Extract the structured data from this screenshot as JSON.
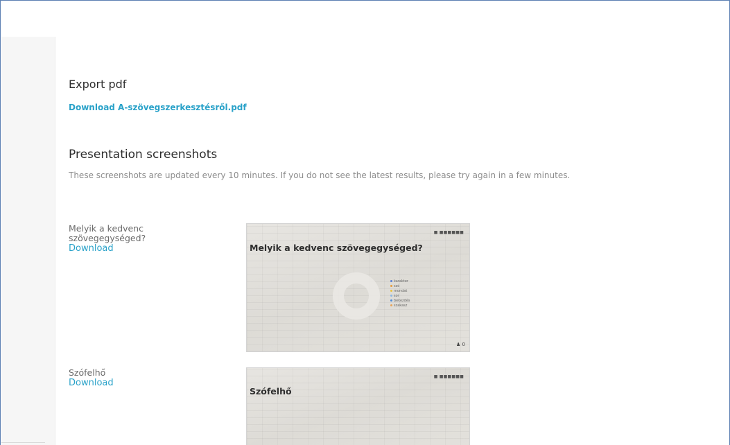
{
  "export": {
    "title": "Export pdf",
    "download_label": "Download A-szövegszerkesztésről.pdf"
  },
  "screenshots": {
    "title": "Presentation screenshots",
    "notice": "These screenshots are updated every 10 minutes. If you do not see the latest results, please try again in a few minutes.",
    "items": [
      {
        "label": "Melyik a kedvenc szövegegységed?",
        "download_label": "Download",
        "slide": {
          "title": "Melyik a kedvenc szövegegységed?",
          "legend": [
            {
              "label": "karakter",
              "color": "#5b7fd1"
            },
            {
              "label": "szó",
              "color": "#e59b3c"
            },
            {
              "label": "mondat",
              "color": "#e8c23e"
            },
            {
              "label": "sor",
              "color": "#8fb7e0"
            },
            {
              "label": "bekezdés",
              "color": "#4f8bd6"
            },
            {
              "label": "szakasz",
              "color": "#e6a45a"
            }
          ]
        }
      },
      {
        "label": "Szófelhő",
        "download_label": "Download",
        "slide": {
          "title": "Szófelhő"
        }
      }
    ]
  }
}
